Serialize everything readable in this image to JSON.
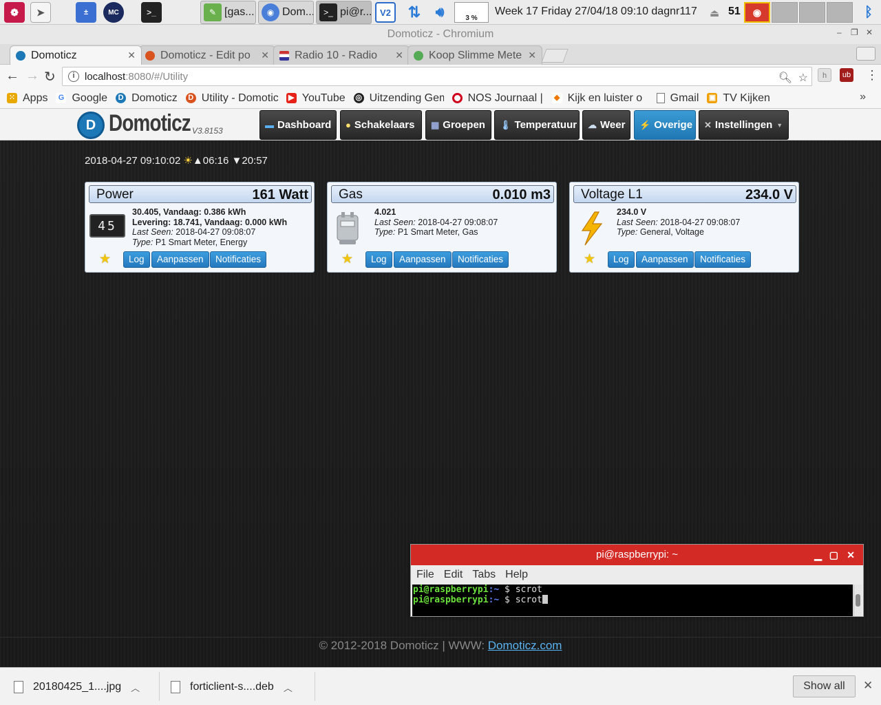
{
  "taskbar": {
    "tasks": [
      "[gas...",
      "Dom...",
      "pi@r..."
    ],
    "cpu_label": "3 %",
    "clock": "Week 17 Friday 27/04/18 09:10 dagnr117",
    "temperature": "51"
  },
  "window": {
    "title": "Domoticz - Chromium"
  },
  "tabs": [
    {
      "label": "Domoticz",
      "fav_color": "#1d78b8"
    },
    {
      "label": "Domoticz - Edit po",
      "fav_color": "#d9531e"
    },
    {
      "label": "Radio 10 - Radio",
      "fav_color": "#e05050"
    },
    {
      "label": "Koop Slimme Mete",
      "fav_color": "#55aa55"
    }
  ],
  "address": {
    "host": "localhost",
    "rest": ":8080/#/Utility"
  },
  "bookmarks": [
    {
      "label": "Apps",
      "icon": "apps-grid-icon",
      "color": "#e8a800"
    },
    {
      "label": "Google",
      "icon": "google-icon",
      "color": "#4285f4"
    },
    {
      "label": "Domoticz",
      "icon": "domoticz-icon",
      "color": "#1d78b8"
    },
    {
      "label": "Utility - Domotic",
      "icon": "domoticz-orange-icon",
      "color": "#d9531e"
    },
    {
      "label": "YouTube",
      "icon": "youtube-icon",
      "color": "#e62117"
    },
    {
      "label": "Uitzending Gem",
      "icon": "npo-icon",
      "color": "#222222"
    },
    {
      "label": "NOS Journaal |",
      "icon": "nos-icon",
      "color": "#d0021b"
    },
    {
      "label": "Kijk en luister o",
      "icon": "kijk-icon",
      "color": "#f07800"
    },
    {
      "label": "Gmail",
      "icon": "document-icon",
      "color": "#777777"
    },
    {
      "label": "TV Kijken",
      "icon": "tv-icon",
      "color": "#f0a000"
    }
  ],
  "domoticz": {
    "title": "Domoticz",
    "version": "V3.8153",
    "nav": [
      {
        "label": "Dashboard",
        "icon": "dashboard-icon"
      },
      {
        "label": "Schakelaars",
        "icon": "lightbulb-icon"
      },
      {
        "label": "Groepen",
        "icon": "scene-icon"
      },
      {
        "label": "Temperatuur",
        "icon": "thermometer-icon"
      },
      {
        "label": "Weer",
        "icon": "weather-icon"
      },
      {
        "label": "Overige",
        "icon": "utility-icon"
      },
      {
        "label": "Instellingen",
        "icon": "tools-icon"
      }
    ],
    "datetime": "2018-04-27 09:10:02",
    "sunrise": "06:16",
    "sunset": "20:57"
  },
  "cards": [
    {
      "name": "Power",
      "value": "161 Watt",
      "line1": "30.405, Vandaag: 0.386 kWh",
      "line2": "Levering: 18.741, Vandaag: 0.000 kWh",
      "last_seen_label": "Last Seen:",
      "last_seen": "2018-04-27 09:08:07",
      "type_label": "Type:",
      "type": "P1 Smart Meter, Energy",
      "meter_digits": "45",
      "buttons": [
        "Log",
        "Aanpassen",
        "Notificaties"
      ]
    },
    {
      "name": "Gas",
      "value": "0.010 m3",
      "line1": "4.021",
      "last_seen_label": "Last Seen:",
      "last_seen": "2018-04-27 09:08:07",
      "type_label": "Type:",
      "type": "P1 Smart Meter, Gas",
      "buttons": [
        "Log",
        "Aanpassen",
        "Notificaties"
      ]
    },
    {
      "name": "Voltage L1",
      "value": "234.0 V",
      "line1": "234.0 V",
      "last_seen_label": "Last Seen:",
      "last_seen": "2018-04-27 09:08:07",
      "type_label": "Type:",
      "type": "General, Voltage",
      "buttons": [
        "Log",
        "Aanpassen",
        "Notificaties"
      ]
    }
  ],
  "terminal": {
    "title": "pi@raspberrypi: ~",
    "menu": [
      "File",
      "Edit",
      "Tabs",
      "Help"
    ],
    "prompt_user": "pi@raspberrypi",
    "prompt_path": ":~",
    "prompt_sign": " $ ",
    "line1_cmd": "scrot",
    "line2_cmd": "scrot"
  },
  "footer": {
    "text": "© 2012-2018 Domoticz | WWW: ",
    "link": "Domoticz.com"
  },
  "downloads": [
    {
      "name": "20180425_1....jpg"
    },
    {
      "name": "forticlient-s....deb"
    }
  ],
  "download_shelf": {
    "show_all": "Show all"
  }
}
